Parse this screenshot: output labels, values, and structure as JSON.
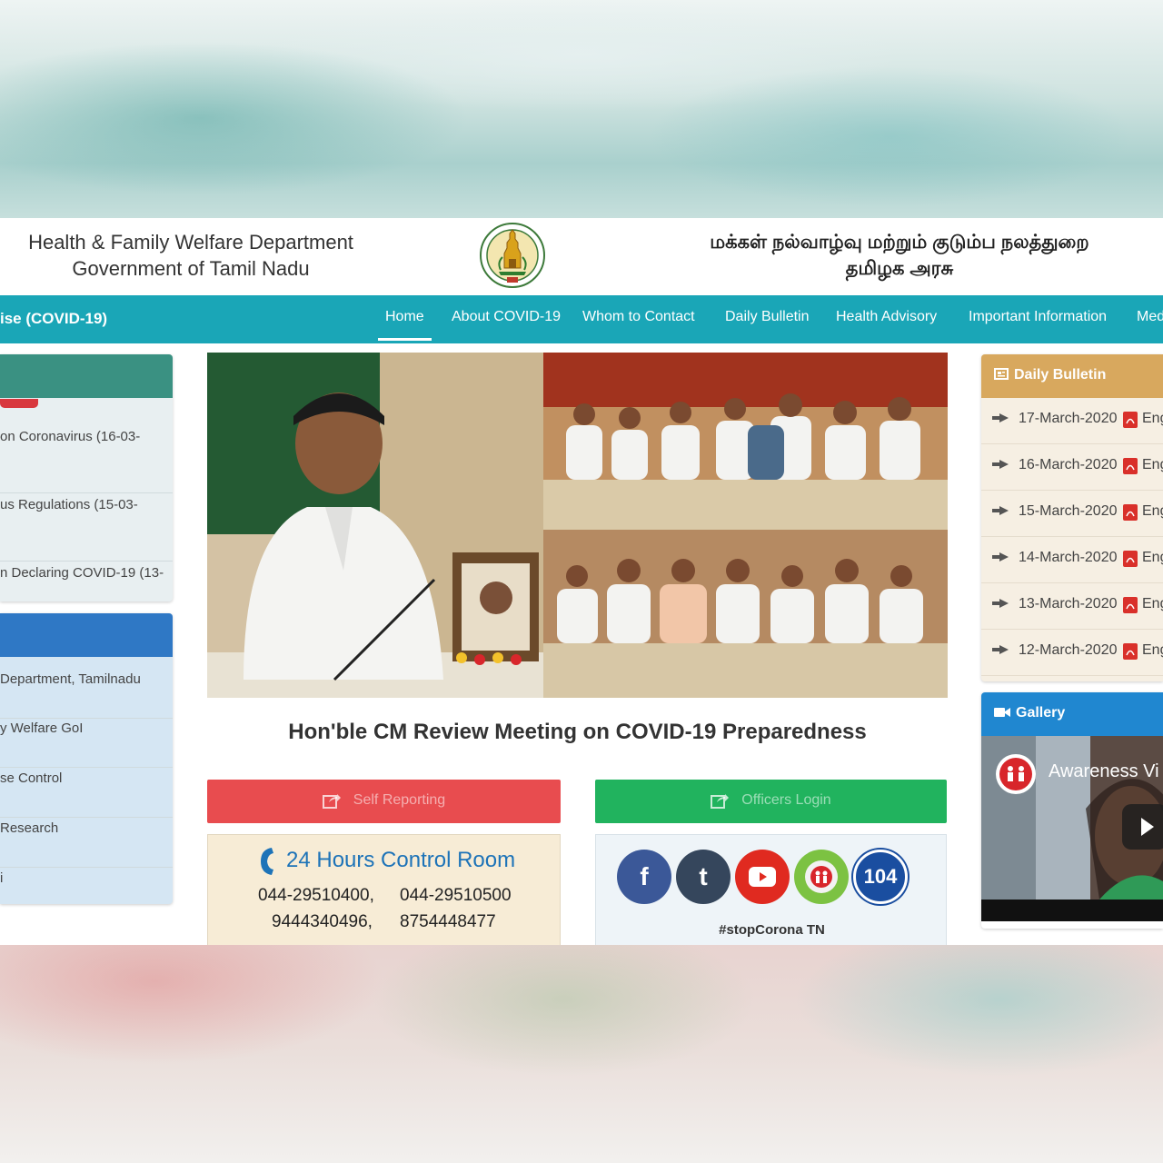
{
  "header": {
    "dept_en_line1": "Health & Family Welfare Department",
    "dept_en_line2": "Government of Tamil Nadu",
    "dept_ta_line1": "மக்கள் நல்வாழ்வு மற்றும் குடும்ப நலத்துறை",
    "dept_ta_line2": "தமிழக அரசு"
  },
  "nav": {
    "brand": "ise (COVID-19)",
    "items": [
      "Home",
      "About COVID-19",
      "Whom to Contact",
      "Daily Bulletin",
      "Health Advisory",
      "Important Information",
      "Med"
    ]
  },
  "left": {
    "panel1_links": [
      "on Coronavirus (16-03-",
      "us Regulations (15-03-",
      "n Declaring COVID-19 (13-"
    ],
    "panel2_links": [
      "Department, Tamilnadu",
      "y Welfare GoI",
      "se Control",
      "Research",
      "i"
    ]
  },
  "main": {
    "caption": "Hon'ble CM Review Meeting on COVID-19 Preparedness",
    "self_reporting": "Self Reporting",
    "officers_login": "Officers Login",
    "control_room_title": "24 Hours Control Room",
    "phones": [
      "044-29510400,",
      "044-29510500",
      "9444340496,",
      "8754448477"
    ],
    "hashtag": "#stopCorona TN",
    "social": {
      "facebook": "f",
      "tumblr": "t",
      "helpline": "104"
    }
  },
  "right": {
    "bulletin_title": "Daily Bulletin",
    "bulletin_items": [
      {
        "date": "17-March-2020",
        "lang": "Eng"
      },
      {
        "date": "16-March-2020",
        "lang": "Eng"
      },
      {
        "date": "15-March-2020",
        "lang": "Eng"
      },
      {
        "date": "14-March-2020",
        "lang": "Eng"
      },
      {
        "date": "13-March-2020",
        "lang": "Eng"
      },
      {
        "date": "12-March-2020",
        "lang": "Eng"
      }
    ],
    "gallery_title": "Gallery",
    "video_title": "Awareness Vi"
  },
  "colors": {
    "nav": "#1aa6b7",
    "self_reporting": "#e84c4f",
    "officers_login": "#21b35e",
    "bulletin_head": "#d8a85e",
    "gallery_head": "#2087d0"
  }
}
